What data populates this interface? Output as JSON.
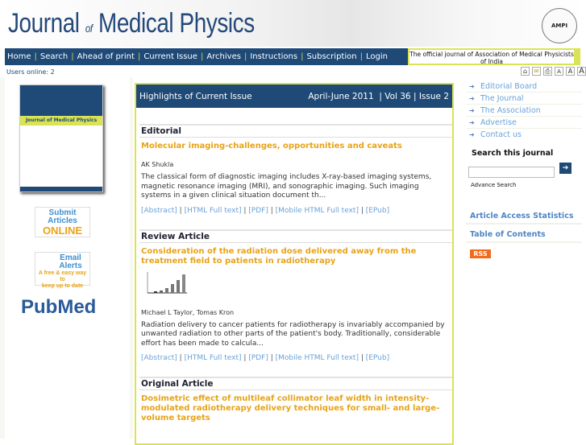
{
  "header": {
    "logo_part1": "Journal ",
    "logo_of": "of",
    "logo_part2": " Medical Physics",
    "seal_text": "AMPI",
    "tagline": "The official journal of Association of Medical Physicists of India"
  },
  "nav": [
    "Home",
    "Search",
    "Ahead of print",
    "Current Issue",
    "Archives",
    "Instructions",
    "Subscription",
    "Login"
  ],
  "users_online": "Users online: 2",
  "tools": {
    "a_small": "A",
    "a_medium": "A",
    "a_large": "A"
  },
  "left": {
    "cover_title": "Journal of Medical Physics",
    "submit_line1": "Submit",
    "submit_line2": "Articles",
    "submit_line3": "ONLINE",
    "email_line1": "Email",
    "email_line2": "Alerts",
    "email_line3": "A free & easy way to",
    "email_line4": "keep up to date",
    "pubmed": "PubMed"
  },
  "main": {
    "heading": "Highlights of Current Issue",
    "issue": "April-June 2011  | Vol 36 | Issue 2",
    "sections": [
      {
        "type": "Editorial",
        "title": "Molecular imaging-challenges, opportunities and caveats",
        "authors": "AK Shukla",
        "abstract": "The classical form of diagnostic imaging includes X-ray-based imaging systems, magnetic resonance imaging (MRI), and sonographic imaging. Such imaging systems in a given clinical situation document th..."
      },
      {
        "type": "Review Article",
        "title": "Consideration of the radiation dose delivered away from the treatment field to patients in radiotherapy",
        "authors": "Michael L Taylor, Tomas Kron",
        "abstract": "Radiation delivery to cancer patients for radiotherapy is invariably accompanied by unwanted radiation to other parts of the patient's body. Traditionally, considerable effort has been made to calcula..."
      },
      {
        "type": "Original Article",
        "title": "Dosimetric effect of multileaf collimator leaf width in intensity-modulated radiotherapy delivery techniques for small- and large-volume targets"
      }
    ],
    "links": [
      "[Abstract]",
      "[HTML Full text]",
      "[PDF]",
      "[Mobile HTML Full text]",
      "[EPub]"
    ]
  },
  "right": {
    "links": [
      "Editorial Board",
      "The Journal",
      "The Association",
      "Advertise",
      "Contact us"
    ],
    "search_title": "Search this journal",
    "search_value": "",
    "advance": "Advance Search",
    "stats": "Article Access Statistics",
    "toc": "Table of Contents",
    "rss": "RSS"
  }
}
